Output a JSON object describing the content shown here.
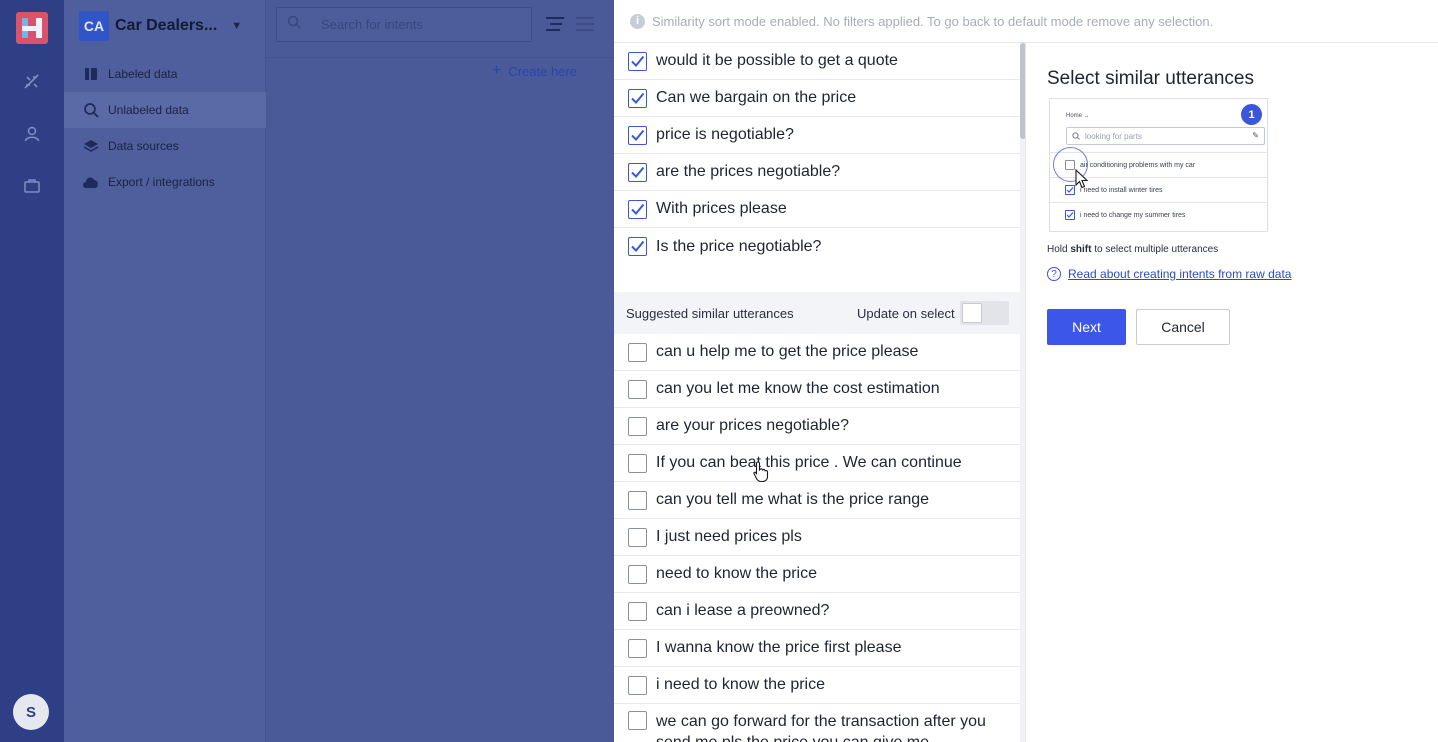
{
  "workspace": {
    "badge": "CA",
    "name": "Car Dealers..."
  },
  "sidenav": {
    "items": [
      {
        "label": "Labeled data",
        "icon": "book-icon"
      },
      {
        "label": "Unlabeled data",
        "icon": "search-icon",
        "active": true
      },
      {
        "label": "Data sources",
        "icon": "layers-icon"
      },
      {
        "label": "Export / integrations",
        "icon": "cloud-icon"
      }
    ]
  },
  "rail": {
    "avatar_initial": "S"
  },
  "topbar": {
    "search_placeholder": "Search for intents",
    "create_label": "Create here"
  },
  "banner": {
    "text": "Similarity sort mode enabled. No filters applied. To go back to default mode remove any selection."
  },
  "selected_utterances": [
    "would it be possible to get a quote",
    "Can we bargain on the price",
    "price is negotiable?",
    "are the prices negotiable?",
    "With prices please",
    "Is the price negotiable?"
  ],
  "suggestions": {
    "header": "Suggested similar utterances",
    "update_label": "Update on select",
    "update_on": false,
    "items": [
      "can u help me to get the price please",
      "can you let me know the cost estimation",
      "are your prices negotiable?",
      "If you can beat this price . We can continue",
      "can you tell me what is the price range",
      "I just need prices pls",
      "need to know the price",
      "can i lease a preowned?",
      "I wanna know the price first please",
      "i need to know the price",
      "we can go forward for the transaction after you send me pls the price you can give me"
    ]
  },
  "guide": {
    "title": "Select similar utterances",
    "preview": {
      "breadcrumb": "Home →",
      "step": "1",
      "search_placeholder": "looking for parts",
      "rows": [
        {
          "text": "air conditioning problems with my car",
          "checked": false
        },
        {
          "text": "i need to install winter tires",
          "checked": true
        },
        {
          "text": "i need to change my summer tires",
          "checked": true
        }
      ]
    },
    "hint_prefix": "Hold ",
    "hint_key": "shift",
    "hint_suffix": " to select multiple utterances",
    "help_link": "Read about creating intents from raw data",
    "next_label": "Next",
    "cancel_label": "Cancel"
  },
  "colors": {
    "accent": "#3b56e8",
    "rail": "#2f3f86",
    "overlay": "#4a5a99"
  }
}
